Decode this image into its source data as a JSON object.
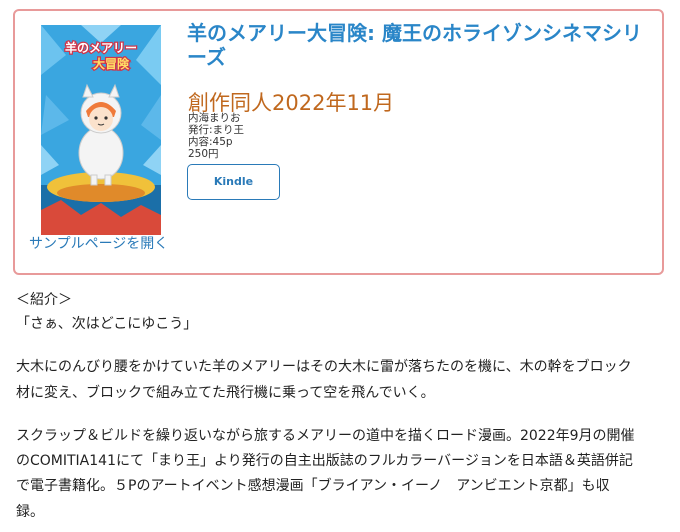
{
  "product": {
    "title": "羊のメアリー大冒険: 魔王のホライゾンシネマシリーズ",
    "cover_title": "羊のメアリー大冒険",
    "date": "創作同人2022年11月",
    "author": "内海まりお",
    "publisher": "発行:まり王",
    "content": "内容:45p",
    "price": "250円",
    "buy_button": "Kindle",
    "sample_link": "サンプルページを開く"
  },
  "description": {
    "intro_label": "＜紹介＞",
    "quote": "「さぁ、次はどこにゆこう」",
    "para1_line1": "大木にのんびり腰をかけていた羊のメアリーはその大木に雷が落ちたのを機に、木の幹をブロック",
    "para1_line2": "材に変え、ブロックで組み立てた飛行機に乗って空を飛んでいく。",
    "para2_line1": "スクラップ＆ビルドを繰り返いながら旅するメアリーの道中を描くロード漫画。2022年9月の開催",
    "para2_line2": "のCOMITIA141にて「まり王」より発行の自主出版誌のフルカラーバージョンを日本語＆英語併記",
    "para2_line3": "で電子書籍化。５Pのアートイベント感想漫画「ブライアン・イーノ　アンビエント京都」も収",
    "para2_line4": "録。"
  },
  "colors": {
    "card_border": "#e89a9a",
    "title": "#2a86c8",
    "date": "#c0681e",
    "link": "#2a7ab8"
  }
}
